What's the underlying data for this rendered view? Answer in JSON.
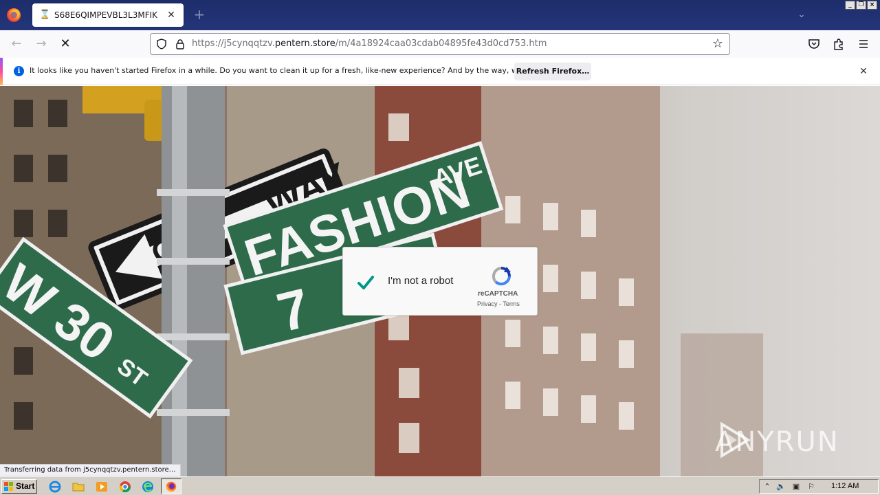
{
  "browser": {
    "tab_title": "S68E6QIMPEVBL3L3MFIK",
    "url_prefix": "https://j5cynqqtzv.",
    "url_host": "pentern.store",
    "url_path": "/m/4a18924caa03cdab04895fe43d0cd753.htm"
  },
  "notification": {
    "message": "It looks like you haven't started Firefox in a while. Do you want to clean it up for a fresh, like-new experience? And by the way, welcome back!",
    "button_label": "Refresh Firefox…"
  },
  "page": {
    "signs": {
      "one_way_top": "WAY",
      "one_way_left": "ON",
      "street_main": "FASHION",
      "street_main_suffix": "AVE",
      "street_number": "7",
      "street_left": "W 30",
      "street_left_suffix": "ST"
    },
    "captcha": {
      "label": "I'm not a robot",
      "brand": "reCAPTCHA",
      "terms": "Privacy - Terms",
      "checked": true
    },
    "watermark_left": "ANY",
    "watermark_right": "RUN"
  },
  "status_text": "Transferring data from j5cynqqtzv.pentern.store…",
  "taskbar": {
    "start_label": "Start",
    "clock": "1:12 AM"
  },
  "colors": {
    "tab_strip": "#1d2d6b",
    "accent_blue": "#0061e0",
    "captcha_check": "#009688",
    "street_sign_green": "#2e6b4a"
  }
}
